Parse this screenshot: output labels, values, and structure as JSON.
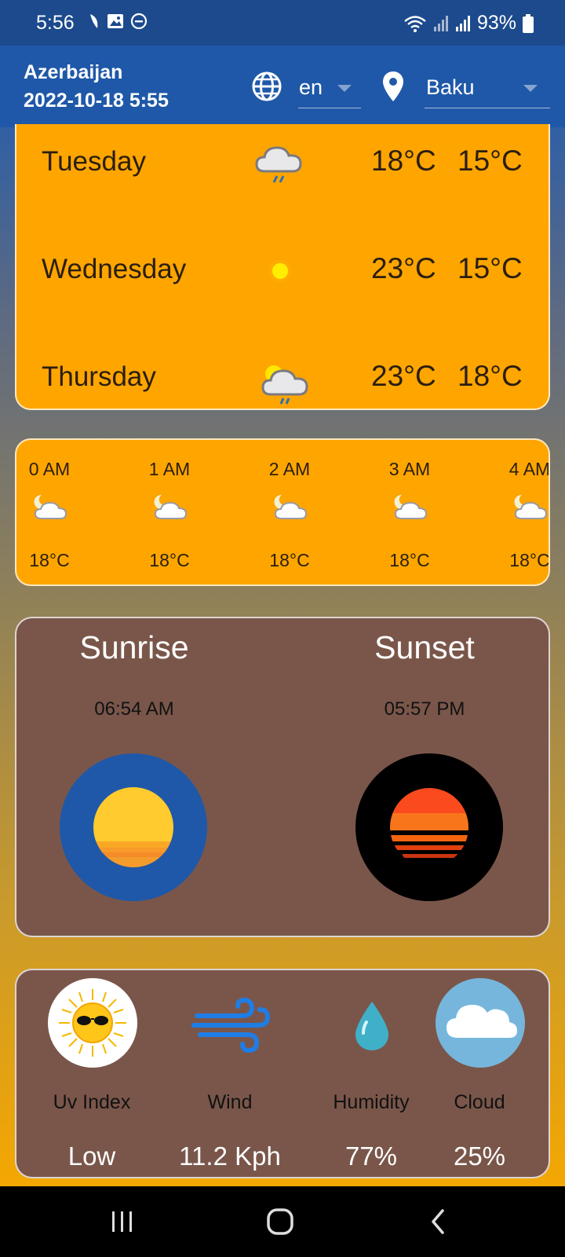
{
  "status_bar": {
    "time": "5:56",
    "battery": "93%",
    "icons": [
      "notification-icon",
      "gallery-icon",
      "dnd-icon",
      "wifi-icon",
      "signal-icon",
      "signal-icon",
      "battery-icon"
    ]
  },
  "header": {
    "country": "Azerbaijan",
    "datetime": "2022-10-18 5:55",
    "language": "en",
    "city": "Baku"
  },
  "daily": [
    {
      "day": "Tuesday",
      "icon": "rain-cloud-icon",
      "max": "18°C",
      "min": "15°C"
    },
    {
      "day": "Wednesday",
      "icon": "sun-icon",
      "max": "23°C",
      "min": "15°C"
    },
    {
      "day": "Thursday",
      "icon": "partly-cloudy-rain-icon",
      "max": "23°C",
      "min": "18°C"
    }
  ],
  "hourly": [
    {
      "time": "0 AM",
      "icon": "moon-cloud-icon",
      "temp": "18°C"
    },
    {
      "time": "1 AM",
      "icon": "moon-cloud-icon",
      "temp": "18°C"
    },
    {
      "time": "2 AM",
      "icon": "moon-cloud-icon",
      "temp": "18°C"
    },
    {
      "time": "3 AM",
      "icon": "moon-cloud-icon",
      "temp": "18°C"
    },
    {
      "time": "4 AM",
      "icon": "moon-cloud-icon",
      "temp": "18°C"
    }
  ],
  "sun": {
    "sunrise_label": "Sunrise",
    "sunrise_time": "06:54 AM",
    "sunset_label": "Sunset",
    "sunset_time": "05:57 PM"
  },
  "stats": [
    {
      "label": "Uv Index",
      "value": "Low",
      "icon": "sunglasses-sun-icon"
    },
    {
      "label": "Wind",
      "value": "11.2 Kph",
      "icon": "wind-icon"
    },
    {
      "label": "Humidity",
      "value": "77%",
      "icon": "water-drop-icon"
    },
    {
      "label": "Cloud",
      "value": "25%",
      "icon": "cloud-icon"
    }
  ],
  "colors": {
    "header": "#1f58a8",
    "card_orange": "#ffa500",
    "card_brown": "#7a564a",
    "sunrise_ring": "#1f58a8",
    "sunset_ring": "#000000"
  }
}
